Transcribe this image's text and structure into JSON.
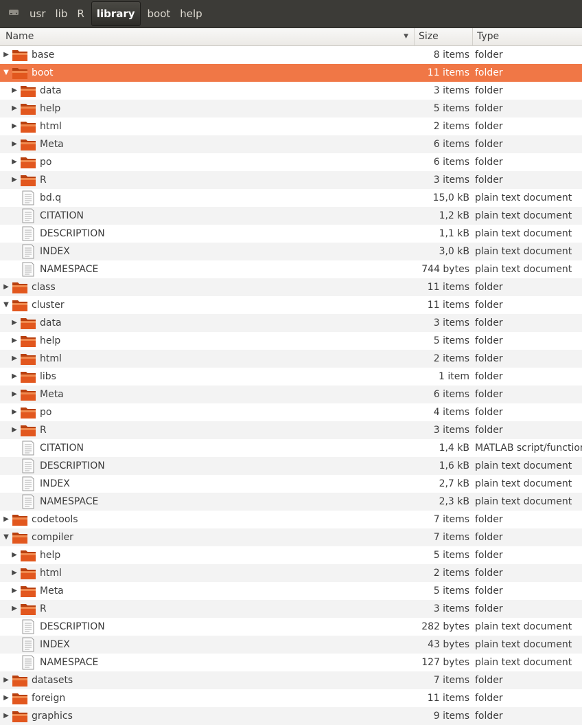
{
  "pathbar": {
    "drive_icon": "drive-icon",
    "crumbs": [
      "usr",
      "lib",
      "R",
      "library",
      "boot",
      "help"
    ],
    "active_index": 3
  },
  "columns": {
    "name": "Name",
    "size": "Size",
    "type": "Type",
    "sort_icon": "chevron-down-icon"
  },
  "colors": {
    "selection": "#f07746",
    "folder": "#e0551d",
    "pathbar_bg": "#3c3b37"
  },
  "rows": [
    {
      "name": "base",
      "size": "8 items",
      "type": "folder",
      "depth": 0,
      "kind": "folder",
      "expanded": false
    },
    {
      "name": "boot",
      "size": "11 items",
      "type": "folder",
      "depth": 0,
      "kind": "folder",
      "expanded": true,
      "selected": true
    },
    {
      "name": "data",
      "size": "3 items",
      "type": "folder",
      "depth": 1,
      "kind": "folder",
      "expanded": false
    },
    {
      "name": "help",
      "size": "5 items",
      "type": "folder",
      "depth": 1,
      "kind": "folder",
      "expanded": false
    },
    {
      "name": "html",
      "size": "2 items",
      "type": "folder",
      "depth": 1,
      "kind": "folder",
      "expanded": false
    },
    {
      "name": "Meta",
      "size": "6 items",
      "type": "folder",
      "depth": 1,
      "kind": "folder",
      "expanded": false
    },
    {
      "name": "po",
      "size": "6 items",
      "type": "folder",
      "depth": 1,
      "kind": "folder",
      "expanded": false
    },
    {
      "name": "R",
      "size": "3 items",
      "type": "folder",
      "depth": 1,
      "kind": "folder",
      "expanded": false
    },
    {
      "name": "bd.q",
      "size": "15,0 kB",
      "type": "plain text document",
      "depth": 1,
      "kind": "file"
    },
    {
      "name": "CITATION",
      "size": "1,2 kB",
      "type": "plain text document",
      "depth": 1,
      "kind": "file"
    },
    {
      "name": "DESCRIPTION",
      "size": "1,1 kB",
      "type": "plain text document",
      "depth": 1,
      "kind": "file"
    },
    {
      "name": "INDEX",
      "size": "3,0 kB",
      "type": "plain text document",
      "depth": 1,
      "kind": "file"
    },
    {
      "name": "NAMESPACE",
      "size": "744 bytes",
      "type": "plain text document",
      "depth": 1,
      "kind": "file"
    },
    {
      "name": "class",
      "size": "11 items",
      "type": "folder",
      "depth": 0,
      "kind": "folder",
      "expanded": false
    },
    {
      "name": "cluster",
      "size": "11 items",
      "type": "folder",
      "depth": 0,
      "kind": "folder",
      "expanded": true
    },
    {
      "name": "data",
      "size": "3 items",
      "type": "folder",
      "depth": 1,
      "kind": "folder",
      "expanded": false
    },
    {
      "name": "help",
      "size": "5 items",
      "type": "folder",
      "depth": 1,
      "kind": "folder",
      "expanded": false
    },
    {
      "name": "html",
      "size": "2 items",
      "type": "folder",
      "depth": 1,
      "kind": "folder",
      "expanded": false
    },
    {
      "name": "libs",
      "size": "1 item",
      "type": "folder",
      "depth": 1,
      "kind": "folder",
      "expanded": false
    },
    {
      "name": "Meta",
      "size": "6 items",
      "type": "folder",
      "depth": 1,
      "kind": "folder",
      "expanded": false
    },
    {
      "name": "po",
      "size": "4 items",
      "type": "folder",
      "depth": 1,
      "kind": "folder",
      "expanded": false
    },
    {
      "name": "R",
      "size": "3 items",
      "type": "folder",
      "depth": 1,
      "kind": "folder",
      "expanded": false
    },
    {
      "name": "CITATION",
      "size": "1,4 kB",
      "type": "MATLAB script/function",
      "depth": 1,
      "kind": "file"
    },
    {
      "name": "DESCRIPTION",
      "size": "1,6 kB",
      "type": "plain text document",
      "depth": 1,
      "kind": "file"
    },
    {
      "name": "INDEX",
      "size": "2,7 kB",
      "type": "plain text document",
      "depth": 1,
      "kind": "file"
    },
    {
      "name": "NAMESPACE",
      "size": "2,3 kB",
      "type": "plain text document",
      "depth": 1,
      "kind": "file"
    },
    {
      "name": "codetools",
      "size": "7 items",
      "type": "folder",
      "depth": 0,
      "kind": "folder",
      "expanded": false
    },
    {
      "name": "compiler",
      "size": "7 items",
      "type": "folder",
      "depth": 0,
      "kind": "folder",
      "expanded": true
    },
    {
      "name": "help",
      "size": "5 items",
      "type": "folder",
      "depth": 1,
      "kind": "folder",
      "expanded": false
    },
    {
      "name": "html",
      "size": "2 items",
      "type": "folder",
      "depth": 1,
      "kind": "folder",
      "expanded": false
    },
    {
      "name": "Meta",
      "size": "5 items",
      "type": "folder",
      "depth": 1,
      "kind": "folder",
      "expanded": false
    },
    {
      "name": "R",
      "size": "3 items",
      "type": "folder",
      "depth": 1,
      "kind": "folder",
      "expanded": false
    },
    {
      "name": "DESCRIPTION",
      "size": "282 bytes",
      "type": "plain text document",
      "depth": 1,
      "kind": "file"
    },
    {
      "name": "INDEX",
      "size": "43 bytes",
      "type": "plain text document",
      "depth": 1,
      "kind": "file"
    },
    {
      "name": "NAMESPACE",
      "size": "127 bytes",
      "type": "plain text document",
      "depth": 1,
      "kind": "file"
    },
    {
      "name": "datasets",
      "size": "7 items",
      "type": "folder",
      "depth": 0,
      "kind": "folder",
      "expanded": false
    },
    {
      "name": "foreign",
      "size": "11 items",
      "type": "folder",
      "depth": 0,
      "kind": "folder",
      "expanded": false
    },
    {
      "name": "graphics",
      "size": "9 items",
      "type": "folder",
      "depth": 0,
      "kind": "folder",
      "expanded": false
    }
  ]
}
